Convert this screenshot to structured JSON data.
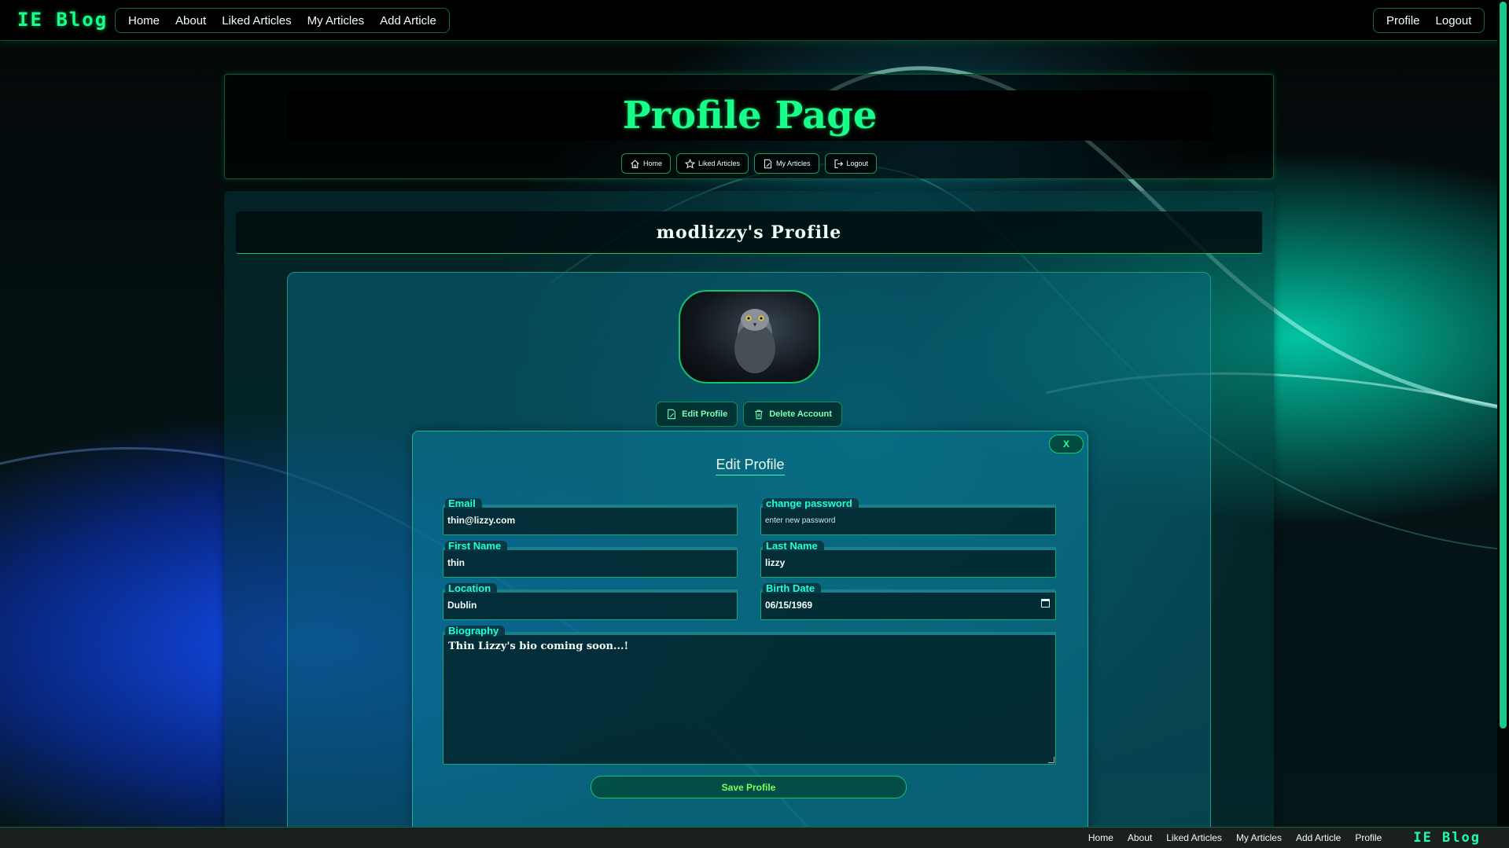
{
  "brand": "IE Blog",
  "nav": {
    "left": [
      "Home",
      "About",
      "Liked Articles",
      "My Articles",
      "Add Article"
    ],
    "right": [
      "Profile",
      "Logout"
    ]
  },
  "header": {
    "title": "Profile Page",
    "buttons": [
      {
        "label": "Home",
        "icon": "home-icon"
      },
      {
        "label": "Liked Articles",
        "icon": "star-icon"
      },
      {
        "label": "My Articles",
        "icon": "document-edit-icon"
      },
      {
        "label": "Logout",
        "icon": "logout-icon"
      }
    ]
  },
  "profile": {
    "heading": "modlizzy's Profile",
    "avatar_alt": "owl avatar",
    "actions": {
      "edit": "Edit Profile",
      "delete": "Delete Account"
    }
  },
  "edit_form": {
    "close_label": "X",
    "title": "Edit Profile",
    "fields": {
      "email": {
        "label": "Email",
        "value": "thin@lizzy.com"
      },
      "password": {
        "label": "change password",
        "placeholder": "enter new password"
      },
      "first_name": {
        "label": "First Name",
        "value": "thin"
      },
      "last_name": {
        "label": "Last Name",
        "value": "lizzy"
      },
      "location": {
        "label": "Location",
        "value": "Dublin"
      },
      "birth_date": {
        "label": "Birth Date",
        "value": "06/15/1969"
      },
      "biography": {
        "label": "Biography",
        "value": "Thin Lizzy's bio coming soon...!"
      }
    },
    "save_label": "Save Profile"
  },
  "footer": {
    "links": [
      "Home",
      "About",
      "Liked Articles",
      "My Articles",
      "Add Article",
      "Profile"
    ],
    "brand": "IE Blog"
  },
  "colors": {
    "accent": "#18ff8a",
    "cyan_label": "#20ffd8",
    "navbar": "#000000"
  }
}
